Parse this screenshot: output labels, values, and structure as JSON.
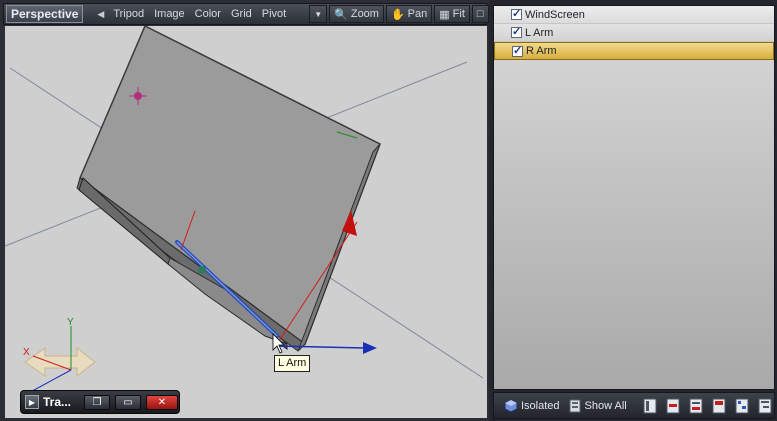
{
  "viewport": {
    "title": "Perspective",
    "menu": [
      "Tripod",
      "Image",
      "Color",
      "Grid",
      "Pivot"
    ],
    "zoom_label": "Zoom",
    "pan_label": "Pan",
    "fit_label": "Fit",
    "tooltip": "L Arm",
    "gizmo_y_label": "Y",
    "gizmo_x_label": "X"
  },
  "tray": {
    "label": "Tra..."
  },
  "scene_list": {
    "items": [
      {
        "label": "WindScreen",
        "checked": true,
        "selected": false
      },
      {
        "label": "L Arm",
        "checked": true,
        "selected": false
      },
      {
        "label": "R Arm",
        "checked": true,
        "selected": true
      }
    ]
  },
  "scene_bottom": {
    "isolated_label": "Isolated",
    "show_all_label": "Show All"
  },
  "colors": {
    "accent_selected": "#d7ae3d",
    "x_axis": "#d11b1b",
    "y_axis": "#1d8c1d",
    "z_axis": "#1a2fb5"
  }
}
